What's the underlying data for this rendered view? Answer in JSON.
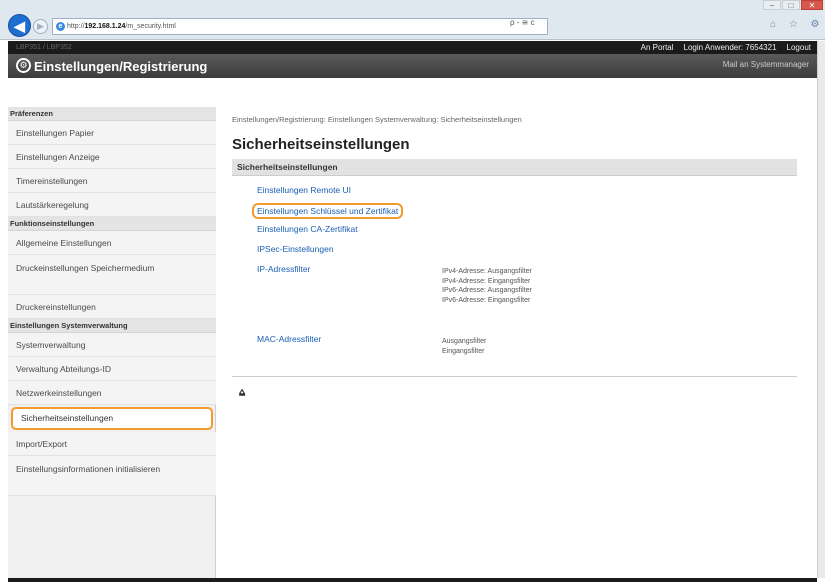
{
  "browser": {
    "url_prefix": "http://",
    "url_host": "192.168.1.24",
    "url_path": "/m_security.html",
    "search_hint": "ρ - ≅ c",
    "back_label": "◀",
    "forward_label": "▶",
    "ie_icon": "e",
    "win": {
      "min": "–",
      "max": "□",
      "close": "✕"
    },
    "tab_icons": "⌂ ☆ ⚙"
  },
  "app": {
    "device_name": "LBP351 / LBP352",
    "topbar": {
      "portal": "An Portal",
      "login_label": "Login Anwender:",
      "login_user": "7654321",
      "logout": "Logout"
    },
    "header_title": "Einstellungen/Registrierung",
    "mail": "Mail an Systemmanager"
  },
  "sidebar": {
    "groups": [
      {
        "title": "Präferenzen",
        "items": [
          "Einstellungen Papier",
          "Einstellungen Anzeige",
          "Timereinstellungen",
          "Lautstärkeregelung"
        ]
      },
      {
        "title": "Funktionseinstellungen",
        "items": [
          "Allgemeine Einstellungen",
          "Druckeinstellungen Speichermedium",
          "Druckereinstellungen"
        ]
      },
      {
        "title": "Einstellungen Systemverwaltung",
        "items": [
          "Systemverwaltung",
          "Verwaltung Abteilungs-ID",
          "Netzwerkeinstellungen",
          "Sicherheitseinstellungen",
          "Import/Export",
          "Einstellungsinformationen initialisieren"
        ]
      }
    ]
  },
  "main": {
    "breadcrumb": "Einstellungen/Registrierung: Einstellungen Systemverwaltung: Sicherheitseinstellungen",
    "title": "Sicherheitseinstellungen",
    "section": "Sicherheitseinstellungen",
    "links": {
      "remote_ui": "Einstellungen Remote UI",
      "key_cert": "Einstellungen Schlüssel und Zertifikat",
      "ca_cert": "Einstellungen CA-Zertifikat",
      "ipsec": "IPSec-Einstellungen",
      "ip_filter": "IP-Adressfilter",
      "mac_filter": "MAC-Adressfilter"
    },
    "ip_filter_desc": [
      "IPv4-Adresse: Ausgangsfilter",
      "IPv4-Adresse: Eingangsfilter",
      "IPv6-Adresse: Ausgangsfilter",
      "IPv6-Adresse: Eingangsfilter"
    ],
    "mac_filter_desc": [
      "Ausgangsfilter",
      "Eingangsfilter"
    ],
    "top_icon": "⩠"
  },
  "colors": {
    "highlight": "#f29b2d",
    "link": "#1a5fb4",
    "header": "#3c3c3c"
  }
}
